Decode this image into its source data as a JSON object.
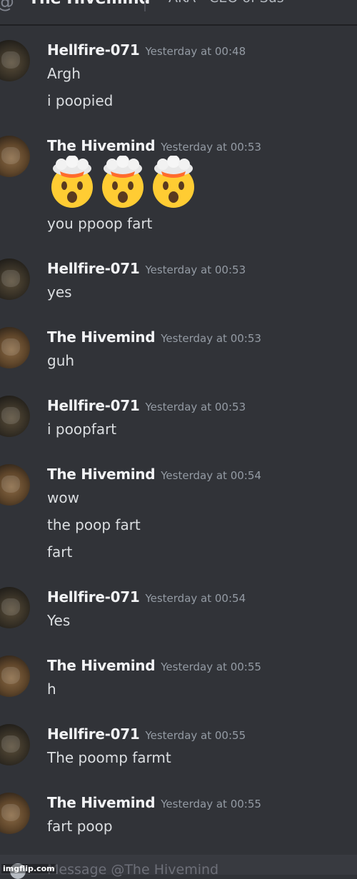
{
  "channel": {
    "title": "The Hivemind",
    "topic": "AKA - CEO of Sus"
  },
  "messages": [
    {
      "author": "Hellfire-071",
      "time": "Yesterday at 00:48",
      "lines": [
        "Argh",
        "i poopied"
      ]
    },
    {
      "author": "The Hivemind",
      "time": "Yesterday at 00:53",
      "emoji_names": [
        "exploding-head-emoji",
        "exploding-head-emoji",
        "exploding-head-emoji"
      ],
      "lines": [
        "you ppoop fart"
      ]
    },
    {
      "author": "Hellfire-071",
      "time": "Yesterday at 00:53",
      "lines": [
        "yes"
      ]
    },
    {
      "author": "The Hivemind",
      "time": "Yesterday at 00:53",
      "lines": [
        "guh"
      ]
    },
    {
      "author": "Hellfire-071",
      "time": "Yesterday at 00:53",
      "lines": [
        "i poopfart"
      ]
    },
    {
      "author": "The Hivemind",
      "time": "Yesterday at 00:54",
      "lines": [
        "wow",
        "the poop fart",
        "fart"
      ]
    },
    {
      "author": "Hellfire-071",
      "time": "Yesterday at 00:54",
      "lines": [
        "Yes"
      ]
    },
    {
      "author": "The Hivemind",
      "time": "Yesterday at 00:55",
      "lines": [
        "h"
      ]
    },
    {
      "author": "Hellfire-071",
      "time": "Yesterday at 00:55",
      "lines": [
        "The poomp farmt"
      ]
    },
    {
      "author": "The Hivemind",
      "time": "Yesterday at 00:55",
      "lines": [
        "fart poop"
      ]
    }
  ],
  "input": {
    "placeholder": "Message @The Hivemind"
  },
  "watermark": "imgflip.com"
}
